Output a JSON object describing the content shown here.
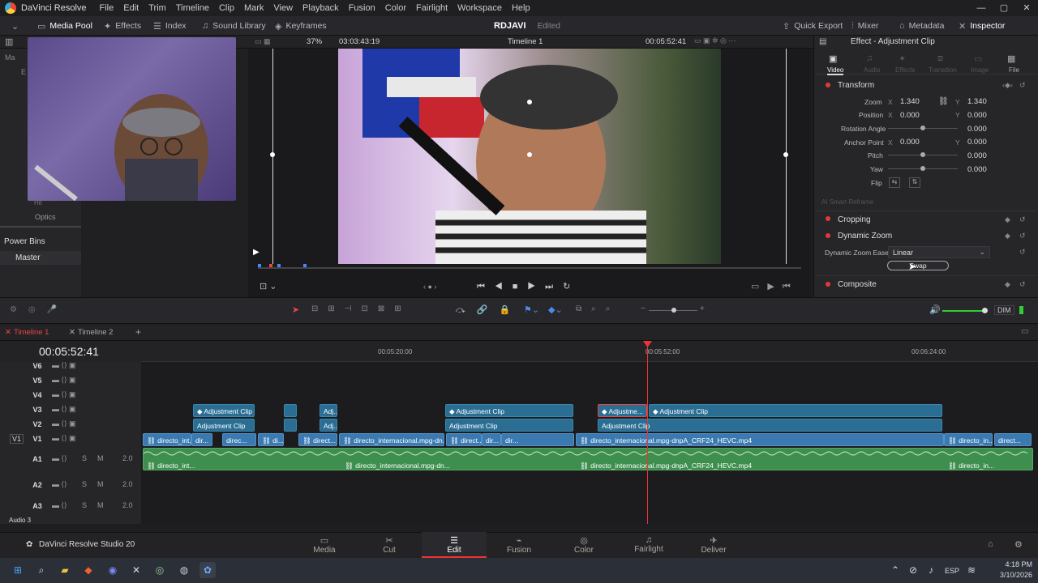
{
  "app": {
    "name": "DaVinci Resolve",
    "project": "RDJAVI",
    "status": "Edited"
  },
  "menu": [
    "File",
    "Edit",
    "Trim",
    "Timeline",
    "Clip",
    "Mark",
    "View",
    "Playback",
    "Fusion",
    "Color",
    "Fairlight",
    "Workspace",
    "Help"
  ],
  "toolbar": {
    "media_pool": "Media Pool",
    "effects": "Effects",
    "index": "Index",
    "sound_library": "Sound Library",
    "keyframes": "Keyframes",
    "quick_export": "Quick Export",
    "mixer": "Mixer",
    "metadata": "Metadata",
    "inspector": "Inspector"
  },
  "viewer": {
    "zoom": "37%",
    "source_tc": "03:03:43:19",
    "timeline_name": "Timeline 1",
    "record_tc": "00:05:52:41"
  },
  "left_panel": {
    "ma": "Ma",
    "e": "E",
    "hit": "Hit",
    "optics": "Optics",
    "power_bins": "Power Bins",
    "master": "Master"
  },
  "inspector": {
    "header": "Effect - Adjustment Clip",
    "tabs": [
      "Video",
      "Audio",
      "Effects",
      "Transition",
      "Image",
      "File"
    ],
    "transform": {
      "title": "Transform",
      "zoom_label": "Zoom",
      "zoom_x": "1.340",
      "zoom_y": "1.340",
      "position_label": "Position",
      "position_x": "0.000",
      "position_y": "0.000",
      "rotation_label": "Rotation Angle",
      "rotation": "0.000",
      "anchor_label": "Anchor Point",
      "anchor_x": "0.000",
      "anchor_y": "0.000",
      "pitch_label": "Pitch",
      "pitch": "0.000",
      "yaw_label": "Yaw",
      "yaw": "0.000",
      "flip_label": "Flip",
      "x": "X",
      "y": "Y"
    },
    "smart_reframe": "AI Smart Reframe",
    "cropping": "Cropping",
    "dynamic_zoom": "Dynamic Zoom",
    "dz_ease_label": "Dynamic Zoom Ease",
    "dz_ease_value": "Linear",
    "swap": "Swap",
    "composite": "Composite"
  },
  "timeline": {
    "tabs": [
      "Timeline 1",
      "Timeline 2"
    ],
    "timecode": "00:05:52:41",
    "ruler": [
      "00:05:20:00",
      "00:05:52:00",
      "00:06:24:00"
    ],
    "tracks": {
      "v6": "V6",
      "v5": "V5",
      "v4": "V4",
      "v3": "V3",
      "v2": "V2",
      "v1": "V1",
      "a1": "A1",
      "a2": "A2",
      "a3": "A3",
      "audio3": "Audio 3",
      "level": "2.0",
      "s": "S",
      "m": "M"
    },
    "dim": "DIM",
    "clips": {
      "adj": "Adjustment Clip",
      "adj_short": "Adj...",
      "adjme": "Adjustme...",
      "direct_long": "directo_internacional.mpg-dn...",
      "direct_full": "directo_internacional.mpg-dnpA_CRF24_HEVC.mp4",
      "d1": "directo_int...",
      "d2": "dir...",
      "d3": "direc...",
      "d4": "di...",
      "d5": "direct...",
      "d6": "directo_in...",
      "d7": "direct..."
    }
  },
  "pages": [
    "Media",
    "Cut",
    "Edit",
    "Fusion",
    "Color",
    "Fairlight",
    "Deliver"
  ],
  "brand": "DaVinci Resolve Studio 20",
  "taskbar": {
    "lang": "ESP",
    "time": "4:18 PM",
    "date": "3/10/2026"
  }
}
